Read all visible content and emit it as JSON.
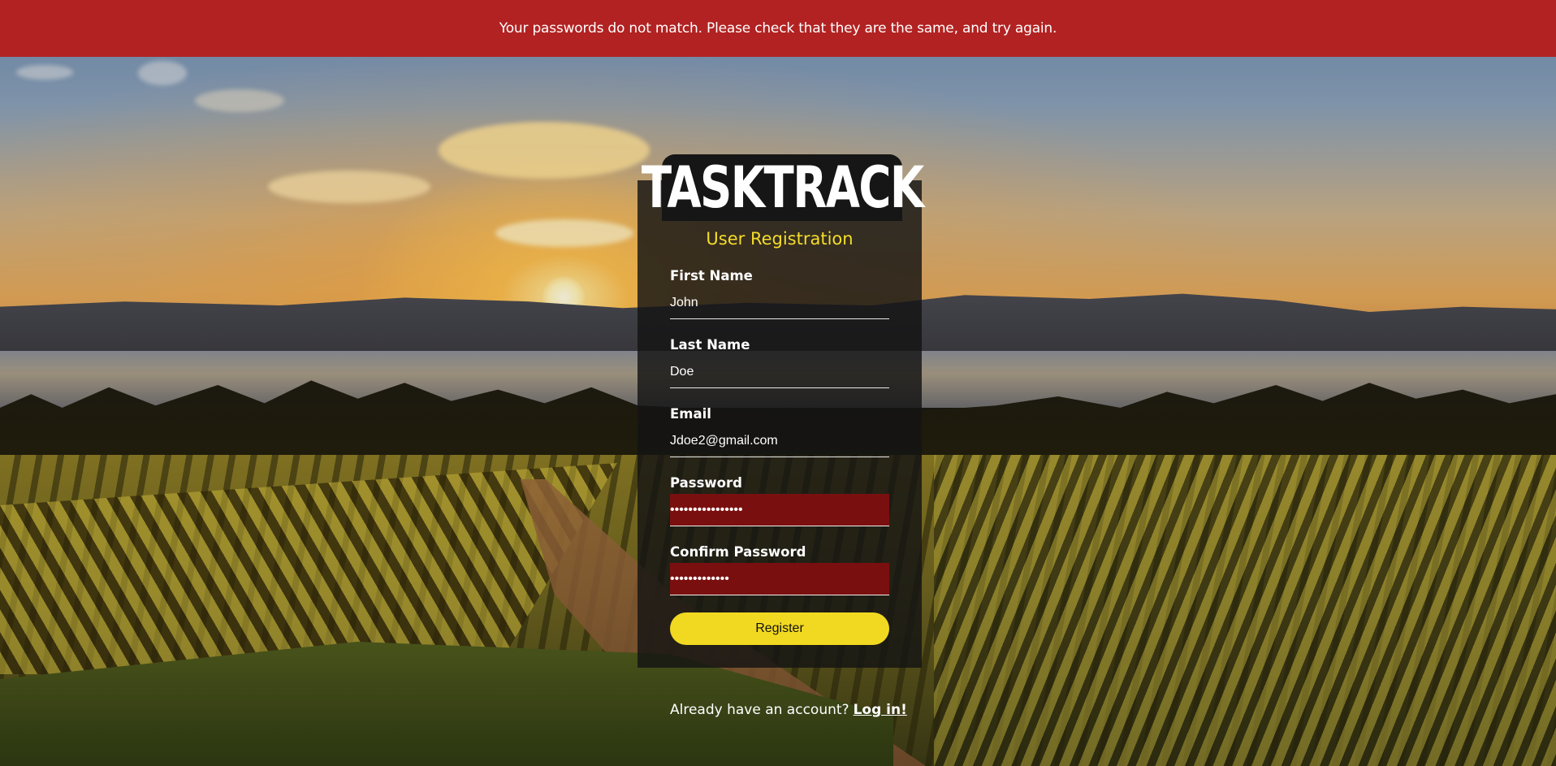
{
  "banner": {
    "message": "Your passwords do not match. Please check that they are the same, and try again.",
    "color": "#b22222"
  },
  "brand": {
    "logo_text": "TASKTRACK"
  },
  "form": {
    "title": "User Registration",
    "first_name": {
      "label": "First Name",
      "value": "John"
    },
    "last_name": {
      "label": "Last Name",
      "value": "Doe"
    },
    "email": {
      "label": "Email",
      "value": "Jdoe2@gmail.com"
    },
    "password": {
      "label": "Password",
      "value": "••••••••••••••••",
      "state": "error"
    },
    "confirm_password": {
      "label": "Confirm Password",
      "value": "•••••••••••••",
      "state": "error"
    },
    "submit_label": "Register",
    "accent_color": "#f2d921"
  },
  "footer": {
    "prompt": "Already have an account?",
    "login_link": "Log in!"
  }
}
